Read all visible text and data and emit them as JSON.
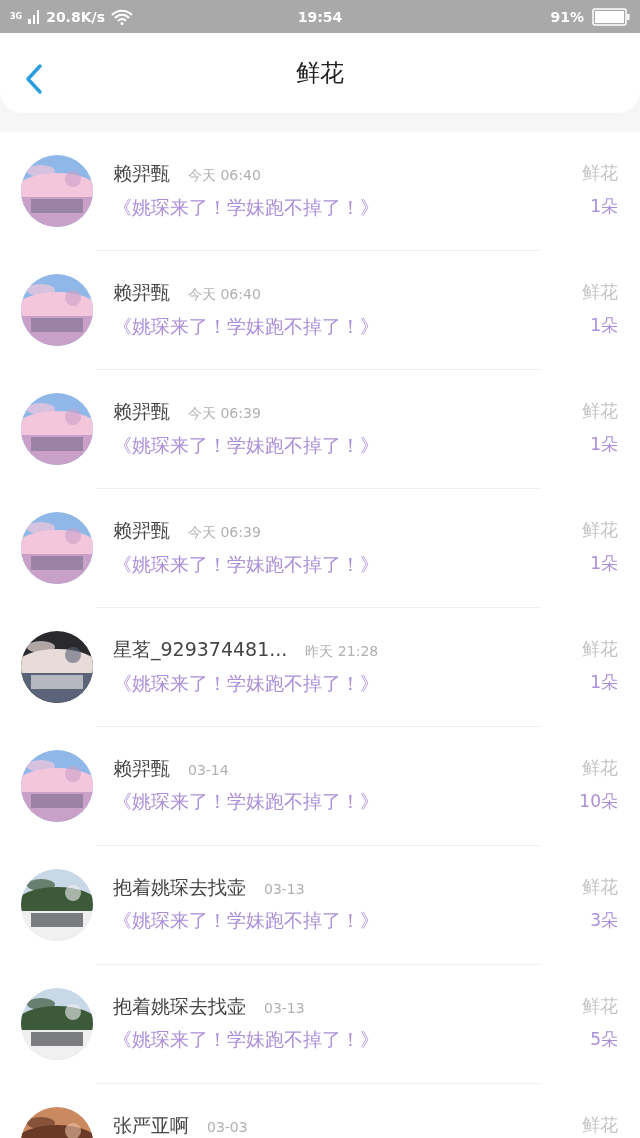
{
  "status_bar": {
    "network": "3G",
    "speed": "20.8K/s",
    "time": "19:54",
    "battery": "91%"
  },
  "header": {
    "title": "鲜花"
  },
  "items": [
    {
      "name": "赖羿甄",
      "time": "今天 06:40",
      "message": "《姚琛来了！学妹跑不掉了！》",
      "gift": "鲜花",
      "count": "1朵"
    },
    {
      "name": "赖羿甄",
      "time": "今天 06:40",
      "message": "《姚琛来了！学妹跑不掉了！》",
      "gift": "鲜花",
      "count": "1朵"
    },
    {
      "name": "赖羿甄",
      "time": "今天 06:39",
      "message": "《姚琛来了！学妹跑不掉了！》",
      "gift": "鲜花",
      "count": "1朵"
    },
    {
      "name": "赖羿甄",
      "time": "今天 06:39",
      "message": "《姚琛来了！学妹跑不掉了！》",
      "gift": "鲜花",
      "count": "1朵"
    },
    {
      "name": "星茗_929374481...",
      "time": "昨天 21:28",
      "message": "《姚琛来了！学妹跑不掉了！》",
      "gift": "鲜花",
      "count": "1朵"
    },
    {
      "name": "赖羿甄",
      "time": "03-14",
      "message": "《姚琛来了！学妹跑不掉了！》",
      "gift": "鲜花",
      "count": "10朵"
    },
    {
      "name": "抱着姚琛去找壶",
      "time": "03-13",
      "message": "《姚琛来了！学妹跑不掉了！》",
      "gift": "鲜花",
      "count": "3朵"
    },
    {
      "name": "抱着姚琛去找壶",
      "time": "03-13",
      "message": "《姚琛来了！学妹跑不掉了！》",
      "gift": "鲜花",
      "count": "5朵"
    },
    {
      "name": "张严亚啊",
      "time": "03-03",
      "gift": "鲜花"
    }
  ]
}
